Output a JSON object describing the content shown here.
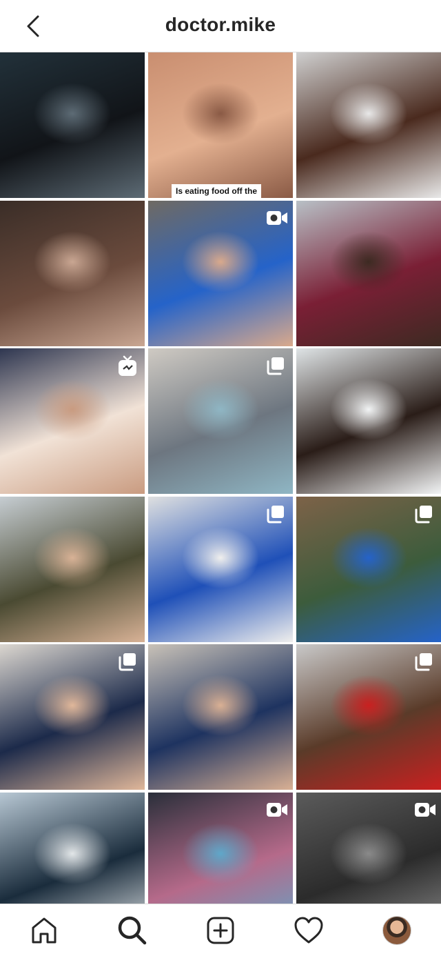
{
  "header": {
    "title": "doctor.mike",
    "back_icon": "chevron-left-icon"
  },
  "grid": {
    "posts": [
      {
        "type": "image",
        "caption": "",
        "colors": [
          "#22313a",
          "#111418",
          "#5d6b75"
        ]
      },
      {
        "type": "image",
        "caption": "Is eating food off the",
        "colors": [
          "#c98e70",
          "#e3b090",
          "#8a5a45"
        ]
      },
      {
        "type": "image",
        "caption": "",
        "colors": [
          "#cfcfcf",
          "#4a2a1e",
          "#e8e8e8"
        ]
      },
      {
        "type": "image",
        "caption": "",
        "colors": [
          "#3a2d27",
          "#6b4b3d",
          "#c9a692"
        ]
      },
      {
        "type": "video",
        "caption": "",
        "colors": [
          "#6f6a63",
          "#2563c9",
          "#d9a98c"
        ]
      },
      {
        "type": "image",
        "caption": "",
        "colors": [
          "#b8c0c6",
          "#7a1f35",
          "#3d2a22"
        ]
      },
      {
        "type": "igtv",
        "caption": "",
        "colors": [
          "#2e3650",
          "#f1e2d6",
          "#c99b80"
        ]
      },
      {
        "type": "carousel",
        "caption": "",
        "colors": [
          "#cfcac3",
          "#6d7680",
          "#8fb6c4"
        ]
      },
      {
        "type": "image",
        "caption": "",
        "colors": [
          "#dfe4e6",
          "#2a1d18",
          "#f2f4f5"
        ]
      },
      {
        "type": "image",
        "caption": "",
        "colors": [
          "#c6cdd2",
          "#4a4a32",
          "#d8b296"
        ]
      },
      {
        "type": "carousel",
        "caption": "",
        "colors": [
          "#dfe0e0",
          "#1f50b8",
          "#f0efed"
        ]
      },
      {
        "type": "carousel",
        "caption": "",
        "colors": [
          "#7d6248",
          "#3c5c3c",
          "#2563c9"
        ]
      },
      {
        "type": "carousel",
        "caption": "",
        "colors": [
          "#dcd7d0",
          "#1c2a4a",
          "#e0b79a"
        ]
      },
      {
        "type": "image",
        "caption": "",
        "colors": [
          "#c9c2b8",
          "#1e3360",
          "#d9b094"
        ]
      },
      {
        "type": "carousel",
        "caption": "",
        "colors": [
          "#c9c9c9",
          "#5a3b29",
          "#c92020"
        ]
      },
      {
        "type": "image",
        "caption": "",
        "colors": [
          "#b7c7d3",
          "#1a2c3c",
          "#e2e6e8"
        ]
      },
      {
        "type": "video",
        "caption": "",
        "colors": [
          "#2a2f3a",
          "#b56a8a",
          "#5fa7c9"
        ]
      },
      {
        "type": "video",
        "caption": "",
        "colors": [
          "#5b5b5b",
          "#2b2b2b",
          "#8a8a8a"
        ]
      }
    ]
  },
  "bottom_nav": {
    "items": [
      "home-icon",
      "search-icon",
      "new-post-icon",
      "activity-heart-icon",
      "profile-avatar"
    ],
    "active": "search-icon"
  }
}
